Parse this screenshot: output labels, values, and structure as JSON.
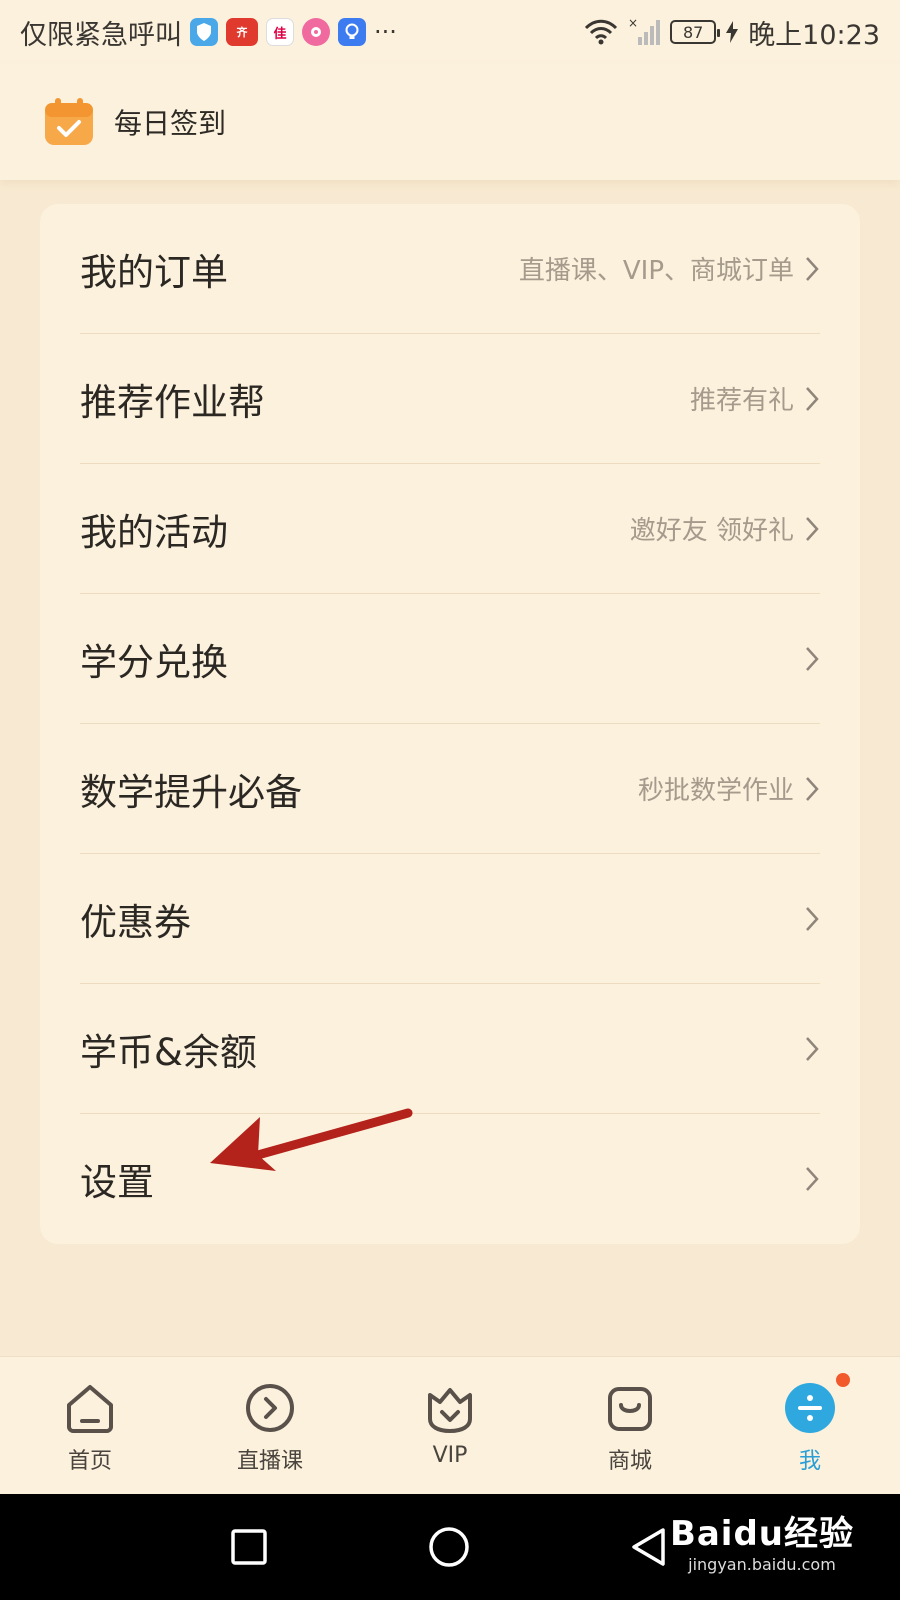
{
  "status_bar": {
    "left_text": "仅限紧急呼叫",
    "app_icons": [
      "shield-app-icon",
      "news-app-icon",
      "game-app-icon",
      "chat-app-icon",
      "bulb-app-icon"
    ],
    "more": "···",
    "battery": "87",
    "time": "晚上10:23"
  },
  "signin": {
    "label": "每日签到"
  },
  "menu": {
    "items": [
      {
        "title": "我的订单",
        "hint": "直播课、VIP、商城订单"
      },
      {
        "title": "推荐作业帮",
        "hint": "推荐有礼"
      },
      {
        "title": "我的活动",
        "hint": "邀好友 领好礼"
      },
      {
        "title": "学分兑换",
        "hint": ""
      },
      {
        "title": "数学提升必备",
        "hint": "秒批数学作业"
      },
      {
        "title": "优惠券",
        "hint": ""
      },
      {
        "title": "学币&余额",
        "hint": ""
      },
      {
        "title": "设置",
        "hint": ""
      }
    ]
  },
  "bottom_nav": {
    "items": [
      {
        "label": "首页",
        "icon": "home-icon"
      },
      {
        "label": "直播课",
        "icon": "play-icon"
      },
      {
        "label": "VIP",
        "icon": "vip-icon"
      },
      {
        "label": "商城",
        "icon": "shop-bag-icon"
      },
      {
        "label": "我",
        "icon": "profile-icon"
      }
    ],
    "active_index": 4
  },
  "watermark": {
    "main": "Baidu经验",
    "sub": "jingyan.baidu.com"
  },
  "colors": {
    "background": "#f8ead2",
    "card": "#fcf1dd",
    "accent": "#2a9fd6",
    "badge": "#f25a2c",
    "arrow": "#b3231b"
  }
}
